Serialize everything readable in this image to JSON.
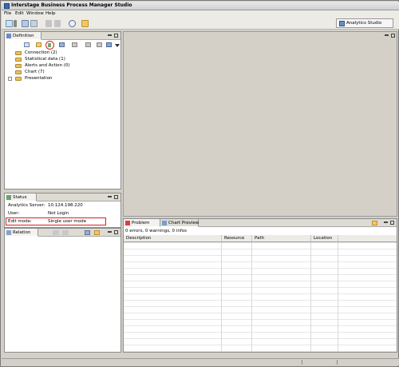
{
  "window": {
    "title": "Interstage Business Process Manager Studio"
  },
  "menu": {
    "file": "File",
    "edit": "Edit",
    "window": "Window",
    "help": "Help"
  },
  "perspective": {
    "label": "Analytics Studio"
  },
  "definition": {
    "tab_label": "Definition",
    "items": [
      {
        "label": "Connection (2)"
      },
      {
        "label": "Statistical data (1)"
      },
      {
        "label": "Alerts and Action (0)"
      },
      {
        "label": "Chart (7)"
      },
      {
        "label": "Presentation"
      }
    ]
  },
  "status_panel": {
    "tab_label": "Status",
    "server_label": "Analytics Server:",
    "server_value": "10.124.198.220",
    "user_label": "User:",
    "user_value": "Not Login",
    "mode_label": "Edit mode:",
    "mode_value": "Single user mode"
  },
  "relation": {
    "tab_label": "Relation"
  },
  "problems": {
    "tab_label": "Problem",
    "tab2_label": "Chart Preview",
    "summary": "0 errors, 0 warnings, 0 infos",
    "columns": [
      "Description",
      "Resource",
      "Path",
      "Location"
    ]
  },
  "accent": {
    "highlight": "#d82020",
    "folder": "#e8c060"
  }
}
